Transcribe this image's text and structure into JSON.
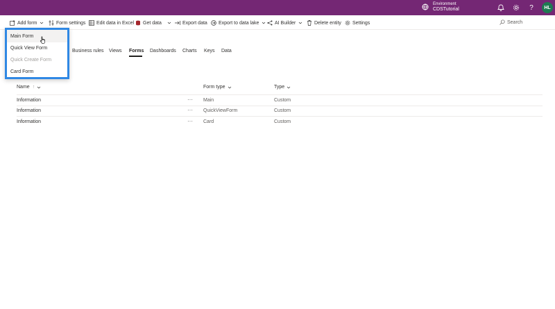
{
  "topbar": {
    "environment_label": "Environment",
    "environment_name": "CDSTutorial",
    "avatar_initials": "HL",
    "help_label": "?"
  },
  "commandbar": {
    "add_form": "Add form",
    "form_settings": "Form settings",
    "edit_excel": "Edit data in Excel",
    "get_data": "Get data",
    "export_data": "Export data",
    "export_lake": "Export to data lake",
    "ai_builder": "AI Builder",
    "delete_entity": "Delete entity",
    "settings": "Settings",
    "search_placeholder": "Search"
  },
  "tabs": [
    "Business rules",
    "Views",
    "Forms",
    "Dashboards",
    "Charts",
    "Keys",
    "Data"
  ],
  "active_tab": "Forms",
  "table": {
    "columns": {
      "name": "Name",
      "sort": "↑",
      "form_type": "Form type",
      "type": "Type"
    },
    "rows": [
      {
        "name": "Information",
        "form_type": "Main",
        "type": "Custom"
      },
      {
        "name": "Information",
        "form_type": "QuickViewForm",
        "type": "Custom"
      },
      {
        "name": "Information",
        "form_type": "Card",
        "type": "Custom"
      }
    ],
    "more_label": "···"
  },
  "dropdown": {
    "items": [
      {
        "label": "Main Form",
        "enabled": true
      },
      {
        "label": "Quick View Form",
        "enabled": true
      },
      {
        "label": "Quick Create Form",
        "enabled": false
      },
      {
        "label": "Card Form",
        "enabled": true
      }
    ]
  },
  "colors": {
    "brand": "#742774",
    "highlight": "#2f88e4",
    "avatar": "#1e7a52"
  }
}
